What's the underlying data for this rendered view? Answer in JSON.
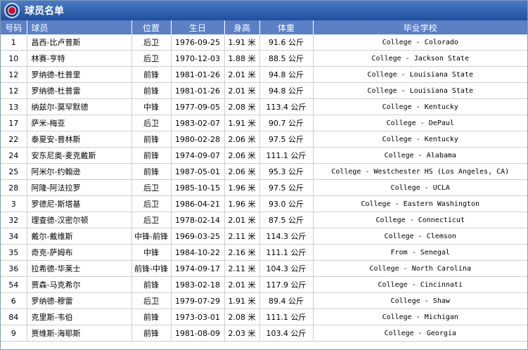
{
  "title": "球员名单",
  "columns": [
    "号码",
    "球员",
    "位置",
    "生日",
    "身高",
    "体重",
    "毕业学校"
  ],
  "players": [
    {
      "num": "1",
      "name": "昌西-比卢普斯",
      "pos": "后卫",
      "birth": "1976-09-25",
      "height": "1.91 米",
      "weight": "91.6 公斤",
      "school": "College - Colorado"
    },
    {
      "num": "10",
      "name": "林赛-亨特",
      "pos": "后卫",
      "birth": "1970-12-03",
      "height": "1.88 米",
      "weight": "88.5 公斤",
      "school": "College - Jackson State"
    },
    {
      "num": "12",
      "name": "罗纳德-杜普里",
      "pos": "前锋",
      "birth": "1981-01-26",
      "height": "2.01 米",
      "weight": "94.8 公斤",
      "school": "College - Louisiana State"
    },
    {
      "num": "12",
      "name": "罗纳德-杜普雷",
      "pos": "前锋",
      "birth": "1981-01-26",
      "height": "2.01 米",
      "weight": "94.8 公斤",
      "school": "College - Louisiana State"
    },
    {
      "num": "13",
      "name": "纳兹尔-莫罕默德",
      "pos": "中锋",
      "birth": "1977-09-05",
      "height": "2.08 米",
      "weight": "113.4 公斤",
      "school": "College - Kentucky"
    },
    {
      "num": "17",
      "name": "萨米-梅亚",
      "pos": "后卫",
      "birth": "1983-02-07",
      "height": "1.91 米",
      "weight": "90.7 公斤",
      "school": "College - DePaul"
    },
    {
      "num": "22",
      "name": "泰夏安-普林斯",
      "pos": "前锋",
      "birth": "1980-02-28",
      "height": "2.06 米",
      "weight": "97.5 公斤",
      "school": "College - Kentucky"
    },
    {
      "num": "24",
      "name": "安东尼奥-麦克戴斯",
      "pos": "前锋",
      "birth": "1974-09-07",
      "height": "2.06 米",
      "weight": "111.1 公斤",
      "school": "College - Alabama"
    },
    {
      "num": "25",
      "name": "阿米尔-约翰逊",
      "pos": "前锋",
      "birth": "1987-05-01",
      "height": "2.06 米",
      "weight": "95.3 公斤",
      "school": "College - Westchester HS (Los Angeles, CA)"
    },
    {
      "num": "28",
      "name": "阿隆-阿法拉罗",
      "pos": "后卫",
      "birth": "1985-10-15",
      "height": "1.96 米",
      "weight": "97.5 公斤",
      "school": "College - UCLA"
    },
    {
      "num": "3",
      "name": "罗德尼-斯塔基",
      "pos": "后卫",
      "birth": "1986-04-21",
      "height": "1.96 米",
      "weight": "93.0 公斤",
      "school": "College - Eastern Washington"
    },
    {
      "num": "32",
      "name": "理查德-汉密尔顿",
      "pos": "后卫",
      "birth": "1978-02-14",
      "height": "2.01 米",
      "weight": "87.5 公斤",
      "school": "College - Connecticut"
    },
    {
      "num": "34",
      "name": "戴尔-戴维斯",
      "pos": "中锋-前锋",
      "birth": "1969-03-25",
      "height": "2.11 米",
      "weight": "114.3 公斤",
      "school": "College - Clemson"
    },
    {
      "num": "35",
      "name": "奇克-萨姆布",
      "pos": "中锋",
      "birth": "1984-10-22",
      "height": "2.16 米",
      "weight": "111.1 公斤",
      "school": "From - Senegal"
    },
    {
      "num": "36",
      "name": "拉希德-华莱士",
      "pos": "前锋-中锋",
      "birth": "1974-09-17",
      "height": "2.11 米",
      "weight": "104.3 公斤",
      "school": "College - North Carolina"
    },
    {
      "num": "54",
      "name": "贾森-马克希尔",
      "pos": "前锋",
      "birth": "1983-02-18",
      "height": "2.01 米",
      "weight": "117.9 公斤",
      "school": "College - Cincinnati"
    },
    {
      "num": "6",
      "name": "罗纳德-穆雷",
      "pos": "后卫",
      "birth": "1979-07-29",
      "height": "1.91 米",
      "weight": "89.4 公斤",
      "school": "College - Shaw"
    },
    {
      "num": "84",
      "name": "克里斯-韦伯",
      "pos": "前锋",
      "birth": "1973-03-01",
      "height": "2.08 米",
      "weight": "111.1 公斤",
      "school": "College - Michigan"
    },
    {
      "num": "9",
      "name": "贾维斯-海耶斯",
      "pos": "前锋",
      "birth": "1981-08-09",
      "height": "2.03 米",
      "weight": "103.4 公斤",
      "school": "College - Georgia"
    }
  ]
}
